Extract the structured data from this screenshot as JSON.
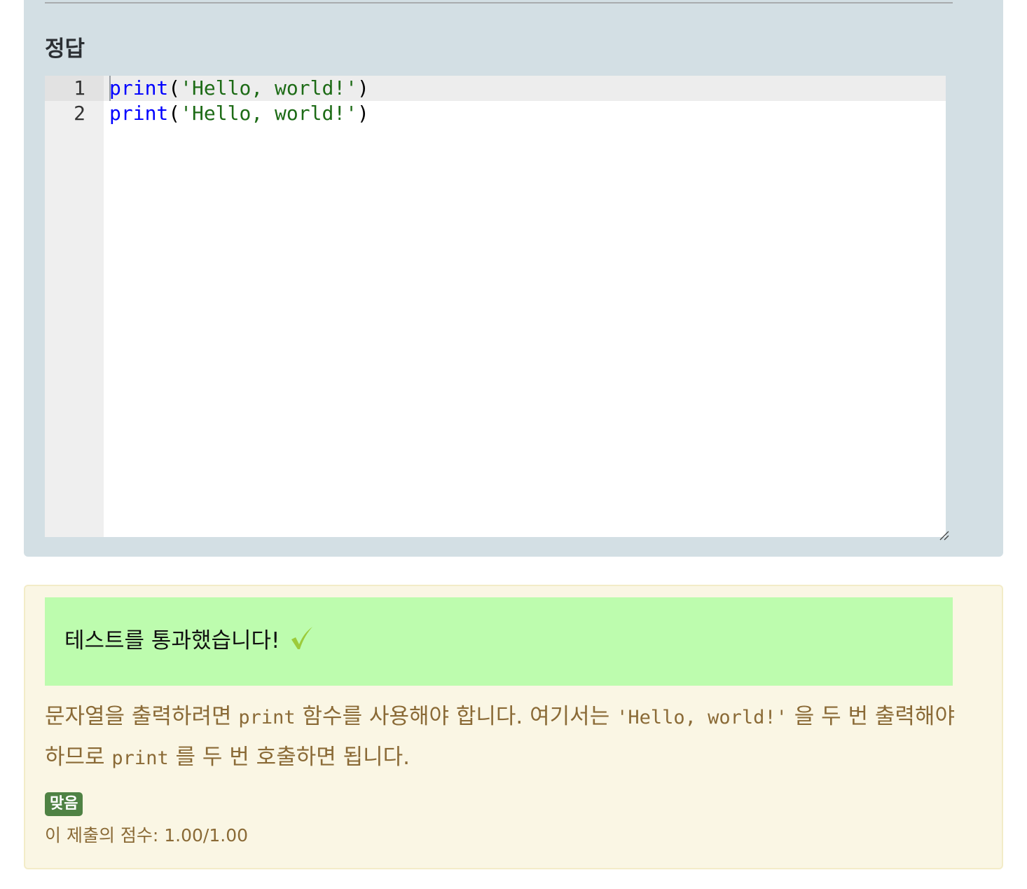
{
  "answer": {
    "heading": "정답",
    "code_lines": [
      {
        "number": "1",
        "func": "print",
        "open": "(",
        "string": "'Hello, world!'",
        "close": ")"
      },
      {
        "number": "2",
        "func": "print",
        "open": "(",
        "string": "'Hello, world!'",
        "close": ")"
      }
    ]
  },
  "feedback": {
    "pass_message": "테스트를 통과했습니다!",
    "check_icon": "checkmark-icon",
    "explanation": {
      "part1": "문자열을 출력하려면 ",
      "code1": "print",
      "part2": " 함수를 사용해야 합니다. 여기서는 ",
      "code2": "'Hello, world!'",
      "part3": " 을 두 번 출력해야 하므로 ",
      "code3": "print",
      "part4": " 를 두 번 호출하면 됩니다."
    },
    "status_badge": "맞음",
    "score_text": "이 제출의 점수: 1.00/1.00"
  },
  "colors": {
    "answer_bg": "#d3dfe4",
    "feedback_bg": "#faf6e4",
    "pass_bg": "#bdfcae",
    "keyword": "#0000ff",
    "string": "#1d6b16",
    "badge_bg": "#4f8244"
  }
}
